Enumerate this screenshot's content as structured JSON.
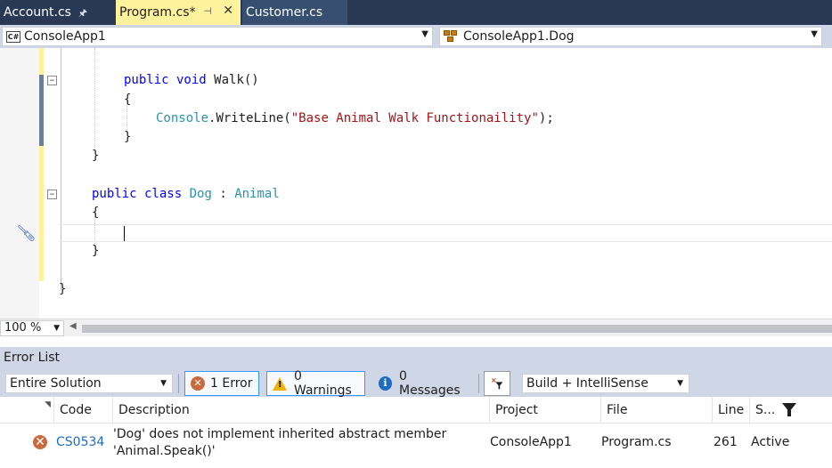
{
  "tabs": [
    {
      "label": "Account.cs",
      "pinned": true,
      "active": false
    },
    {
      "label": "Program.cs*",
      "pinned": true,
      "active": true
    },
    {
      "label": "Customer.cs",
      "pinned": false,
      "active": false
    }
  ],
  "navigation": {
    "project": "ConsoleApp1",
    "type": "ConsoleApp1.Dog"
  },
  "code": {
    "line1": {
      "kw": "public void",
      "name": "Walk()"
    },
    "line2": "{",
    "line3": {
      "type": "Console",
      "call": ".WriteLine(",
      "string": "\"Base Animal Walk Functionaility\"",
      "end": ");"
    },
    "line4": "}",
    "line5": "}",
    "line6": {
      "kw": "public class",
      "name": "Dog",
      "colon": ":",
      "base": "Animal"
    },
    "line7": "{",
    "line8": "}",
    "line9": "}"
  },
  "editor": {
    "zoom": "100 %"
  },
  "error_list": {
    "title": "Error List",
    "scope": "Entire Solution",
    "errors_label": "1 Error",
    "warnings_label": "0 Warnings",
    "messages_label": "0 Messages",
    "build_filter": "Build + IntelliSense",
    "columns": {
      "code": "Code",
      "description": "Description",
      "project": "Project",
      "file": "File",
      "line": "Line",
      "state": "S..."
    },
    "rows": [
      {
        "code": "CS0534",
        "description": "'Dog' does not implement inherited abstract member 'Animal.Speak()'",
        "project": "ConsoleApp1",
        "file": "Program.cs",
        "line": "261",
        "state": "Active"
      }
    ]
  },
  "colors": {
    "tab_bar": "#293955",
    "active_tab": "#fff29d",
    "panel": "#cfd6e5",
    "keyword": "#0000ff",
    "type": "#2b91af",
    "string": "#a31515",
    "error": "#c86a3c"
  },
  "icons": {
    "pin": "pin-icon",
    "close": "close-icon",
    "csharp_project": "csharp-project-icon",
    "class": "class-icon",
    "quick_action": "screwdriver-icon",
    "error": "error-icon",
    "warning": "warning-icon",
    "info": "info-icon",
    "filter": "filter-icon"
  }
}
